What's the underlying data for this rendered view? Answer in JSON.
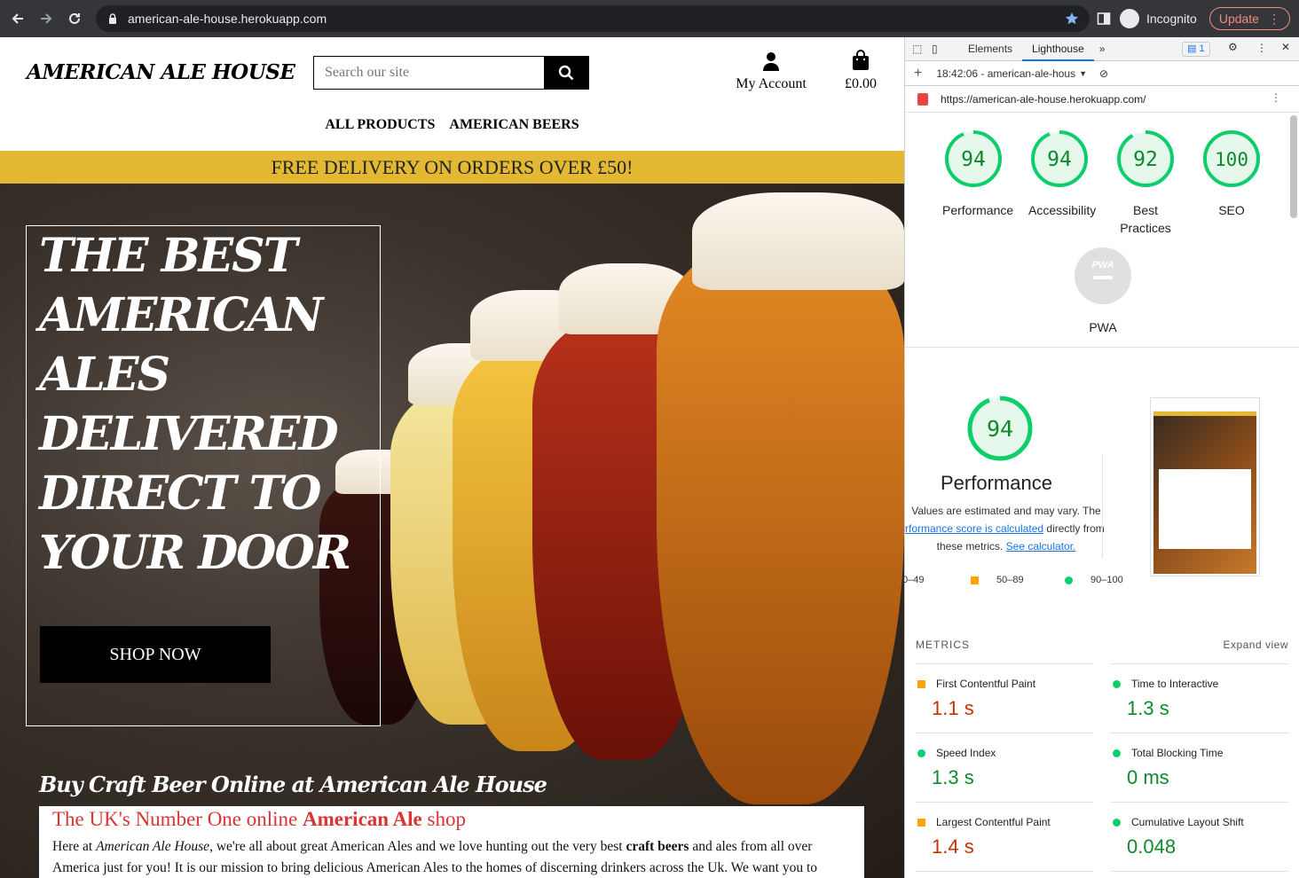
{
  "browser": {
    "url": "american-ale-house.herokuapp.com",
    "profile": "Incognito",
    "update_label": "Update"
  },
  "site": {
    "logo": "AMERICAN ALE HOUSE",
    "search_placeholder": "Search our site",
    "account_label": "My Account",
    "bag_total": "£0.00",
    "nav": [
      "ALL PRODUCTS",
      "AMERICAN BEERS"
    ],
    "delivery_banner": "FREE DELIVERY ON ORDERS OVER £50!",
    "hero_title_lines": [
      "THE BEST",
      "AMERICAN",
      "ALES",
      "DELIVERED",
      "DIRECT TO",
      "YOUR DOOR"
    ],
    "shop_now": "SHOP NOW",
    "hero_subtitle": "Buy Craft Beer Online at American Ale House",
    "intro_heading_pre": "The UK's Number One online ",
    "intro_heading_bold": "American Ale",
    "intro_heading_post": " shop",
    "intro_text_1": "Here at ",
    "intro_text_em": "American Ale House",
    "intro_text_2": ", we're all about great American Ales and we love hunting out the very best ",
    "intro_text_bold": "craft beers",
    "intro_text_3": " and ales from all over America just for you! It is our mission to bring delicious American Ales to the homes of discerning drinkers across the Uk. We want you to"
  },
  "devtools": {
    "tabs": [
      "Elements",
      "Lighthouse"
    ],
    "issues_count": "1",
    "report_label": "18:42:06 - american-ale-hous",
    "page_url": "https://american-ale-house.herokuapp.com/",
    "scores": [
      {
        "label": "Performance",
        "value": "94"
      },
      {
        "label": "Accessibility",
        "value": "94"
      },
      {
        "label": "Best Practices",
        "value": "92"
      },
      {
        "label": "SEO",
        "value": "100"
      }
    ],
    "pwa_label": "PWA",
    "pwa_badge": "PWA",
    "perf_score": "94",
    "perf_title": "Performance",
    "perf_note_1": "Values are estimated and may vary. The",
    "perf_note_link": "rformance score is calculated",
    "perf_note_2": " directly from",
    "perf_note_3": "these metrics. ",
    "perf_note_link2": "See calculator.",
    "legend": [
      "0–49",
      "50–89",
      "90–100"
    ],
    "metrics_title": "METRICS",
    "expand_view": "Expand view",
    "metrics": [
      {
        "name": "First Contentful Paint",
        "value": "1.1 s",
        "status": "average"
      },
      {
        "name": "Time to Interactive",
        "value": "1.3 s",
        "status": "pass"
      },
      {
        "name": "Speed Index",
        "value": "1.3 s",
        "status": "pass"
      },
      {
        "name": "Total Blocking Time",
        "value": "0 ms",
        "status": "pass"
      },
      {
        "name": "Largest Contentful Paint",
        "value": "1.4 s",
        "status": "average"
      },
      {
        "name": "Cumulative Layout Shift",
        "value": "0.048",
        "status": "pass"
      }
    ],
    "colors": {
      "pass": "#0c8a2c",
      "average": "#c33300",
      "accent": "#1a73e8"
    }
  }
}
